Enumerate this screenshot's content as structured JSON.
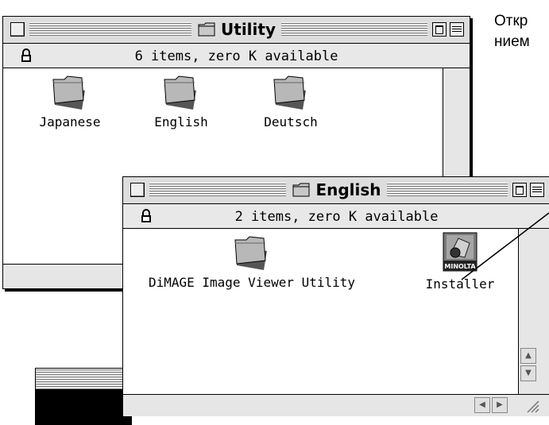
{
  "utility_window": {
    "title": "Utility",
    "info": "6 items, zero K available",
    "items": [
      {
        "label": "Japanese",
        "icon": "folder-icon"
      },
      {
        "label": "English",
        "icon": "folder-icon"
      },
      {
        "label": "Deutsch",
        "icon": "folder-icon"
      }
    ]
  },
  "english_window": {
    "title": "English",
    "info": "2 items, zero K available",
    "items": [
      {
        "label": "DiMAGE Image Viewer Utility",
        "icon": "folder-icon"
      },
      {
        "label": "Installer",
        "icon": "minolta-installer-icon",
        "badge": "MINOLTA"
      }
    ]
  },
  "side_text": {
    "line1": "Откр",
    "line2": "нием"
  },
  "colors": {
    "window_bg": "#ffffff",
    "titlebar_bg": "#dddddd",
    "folder_fill": "#b8b8b8"
  }
}
